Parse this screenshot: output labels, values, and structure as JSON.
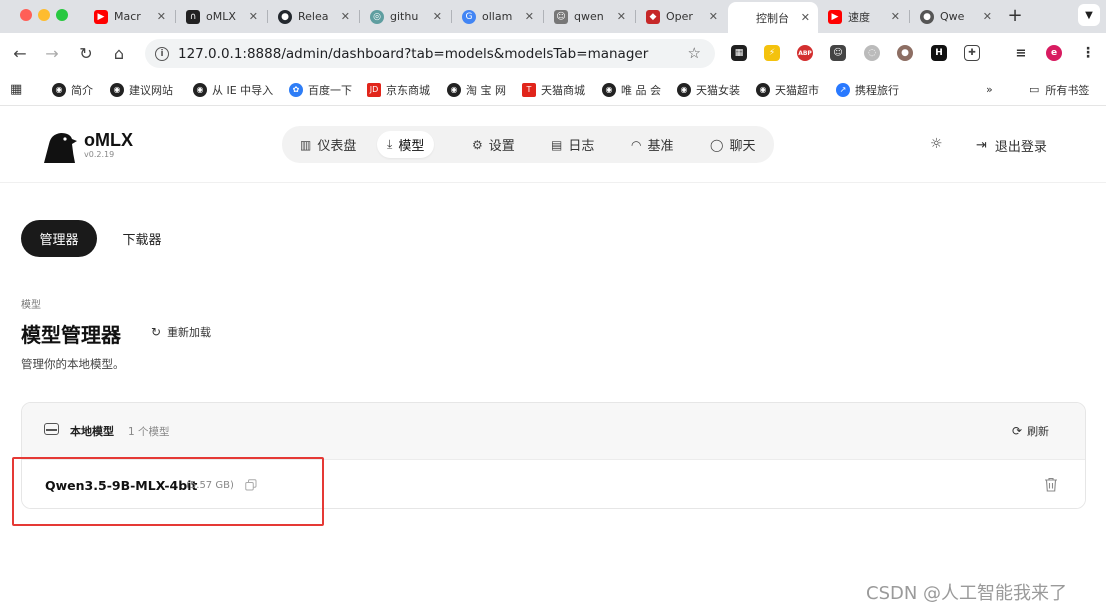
{
  "browser": {
    "tabs": [
      {
        "label": "Macr",
        "icon": "youtube-icon",
        "color": "#ff0000"
      },
      {
        "label": "oMLX",
        "icon": "omlx-favicon",
        "color": "#222222"
      },
      {
        "label": "Relea",
        "icon": "github-icon",
        "color": "#24292f"
      },
      {
        "label": "githu",
        "icon": "globe-icon",
        "color": "#5f9ea0"
      },
      {
        "label": "ollam",
        "icon": "google-icon",
        "color": "#4285f4"
      },
      {
        "label": "qwen",
        "icon": "ollama-icon",
        "color": "#777777"
      },
      {
        "label": "Oper",
        "icon": "openrouter-icon",
        "color": "#c62828"
      },
      {
        "label": "控制台",
        "icon": "console-favicon",
        "color": "#ffffff",
        "active": true
      },
      {
        "label": "速度",
        "icon": "youtube-icon",
        "color": "#ff0000"
      },
      {
        "label": "Qwe",
        "icon": "avatar-icon",
        "color": "#555555"
      }
    ],
    "url": "127.0.0.1:8888/admin/dashboard?tab=models&modelsTab=manager",
    "bookmarks": [
      "简介",
      "建议网站",
      "从 IE 中导入",
      "百度一下",
      "京东商城",
      "淘 宝 网",
      "天猫商城",
      "唯 品 会",
      "天猫女装",
      "天猫超市",
      "携程旅行"
    ],
    "bookmarks_more": "»",
    "bookmarks_all": "所有书签"
  },
  "app": {
    "brand": "oMLX",
    "version": "v0.2.19",
    "nav": [
      {
        "label": "仪表盘",
        "icon": "chart-icon"
      },
      {
        "label": "模型",
        "icon": "download-icon",
        "active": true
      },
      {
        "label": "设置",
        "icon": "gear-icon"
      },
      {
        "label": "日志",
        "icon": "logs-icon"
      },
      {
        "label": "基准",
        "icon": "gauge-icon"
      },
      {
        "label": "聊天",
        "icon": "chat-icon"
      }
    ],
    "logout": "退出登录"
  },
  "models": {
    "subtabs": [
      "管理器",
      "下载器"
    ],
    "breadcrumb": "模型",
    "title": "模型管理器",
    "reload": "重新加载",
    "subtitle": "管理你的本地模型。",
    "card": {
      "title": "本地模型",
      "count": "1 个模型",
      "refresh": "刷新",
      "items": [
        {
          "name": "Qwen3.5-9B-MLX-4bit",
          "size": "(5.57 GB)"
        }
      ]
    }
  },
  "watermark": "CSDN @人工智能我来了",
  "colors": {
    "highlight": "#e53935",
    "active_pill": "#1a1a1a",
    "page_bg": "#ffffff"
  }
}
